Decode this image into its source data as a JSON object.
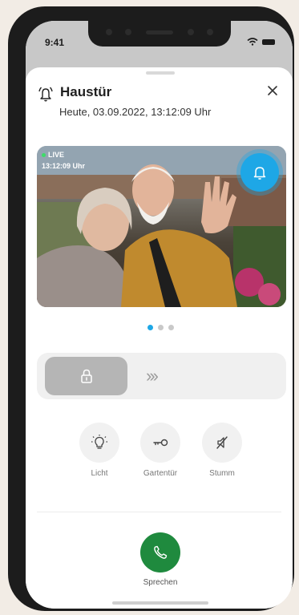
{
  "status_bar": {
    "time": "9:41"
  },
  "notification": {
    "title": "Haustür",
    "timestamp": "Heute, 03.09.2022, 13:12:09 Uhr"
  },
  "video": {
    "live_label": "LIVE",
    "time_overlay": "13:12:09 Uhr",
    "ring_icon": "bell-icon"
  },
  "pager": {
    "count": 3,
    "active": 1
  },
  "unlock_slider": {
    "icon": "lock-icon",
    "arrows": "›››"
  },
  "actions": [
    {
      "label": "Licht",
      "icon": "lightbulb-icon"
    },
    {
      "label": "Gartentür",
      "icon": "key-icon"
    },
    {
      "label": "Stumm",
      "icon": "mute-icon"
    }
  ],
  "talk": {
    "label": "Sprechen",
    "icon": "phone-icon"
  },
  "colors": {
    "accent_blue": "#1ea7e6",
    "talk_green": "#1f8a3e",
    "live_green": "#3ddc68"
  }
}
